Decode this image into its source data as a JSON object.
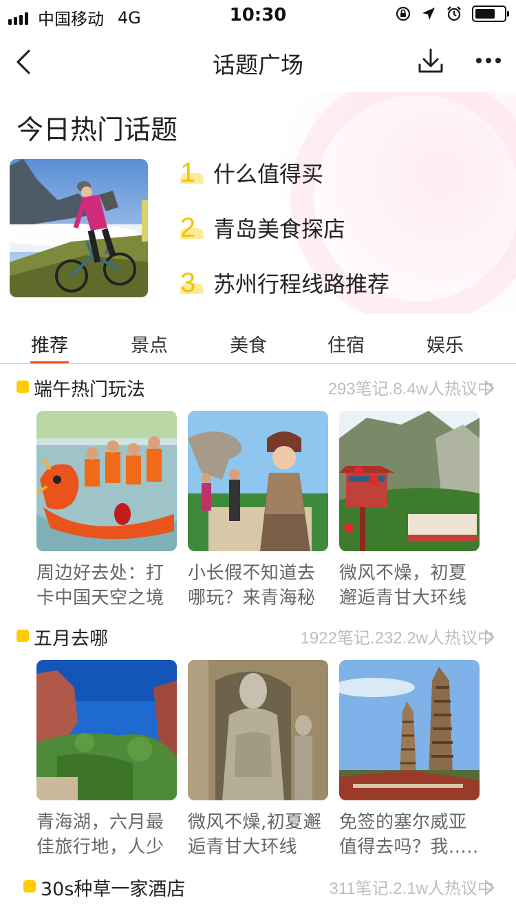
{
  "status_bar": {
    "carrier": "中国移动",
    "network": "4G",
    "time": "10:30",
    "icons": [
      "orientation-lock-icon",
      "location-icon",
      "alarm-icon",
      "battery-icon"
    ]
  },
  "nav": {
    "title": "话题广场",
    "icons": [
      "back-icon",
      "download-icon",
      "more-icon"
    ]
  },
  "hot": {
    "title": "今日热门话题",
    "image": "cyclist-mountain-photo",
    "items": [
      {
        "rank": "1",
        "text": "什么值得买"
      },
      {
        "rank": "2",
        "text": "青岛美食探店"
      },
      {
        "rank": "3",
        "text": "苏州行程线路推荐"
      }
    ]
  },
  "tabs": [
    {
      "label": "推荐",
      "active": true
    },
    {
      "label": "景点",
      "active": false
    },
    {
      "label": "美食",
      "active": false
    },
    {
      "label": "住宿",
      "active": false
    },
    {
      "label": "娱乐",
      "active": false
    }
  ],
  "groups": [
    {
      "title": "端午热门玩法",
      "stats": "293笔记.8.4w人热议中",
      "cards": [
        {
          "caption": "周边好去处：打卡中国天空之境",
          "image": "dragon-boat-photo"
        },
        {
          "caption": "小长假不知道去哪玩？来青海秘",
          "image": "tourist-woman-photo"
        },
        {
          "caption": "微风不燥，初夏邂逅青甘大环线",
          "image": "mountain-temple-photo"
        }
      ]
    },
    {
      "title": "五月去哪",
      "stats": "1922笔记.232.2w人热议中",
      "cards": [
        {
          "caption": "青海湖，六月最佳旅行地，人少",
          "image": "red-cliffs-photo"
        },
        {
          "caption": "微风不燥,初夏邂逅青甘大环线",
          "image": "buddha-grotto-photo"
        },
        {
          "caption": "免签的塞尔威亚值得去吗？我.....",
          "image": "twin-pagodas-photo"
        }
      ]
    },
    {
      "title": "30s种草一家酒店",
      "stats": "311笔记.2.1w人热议中",
      "cards": []
    }
  ],
  "colors": {
    "accent_orange": "#f25a22",
    "rank_yellow": "#f5c400",
    "dot_yellow": "#ffcc00",
    "caption_gray": "#666666",
    "stats_gray": "#bdbdbd"
  }
}
